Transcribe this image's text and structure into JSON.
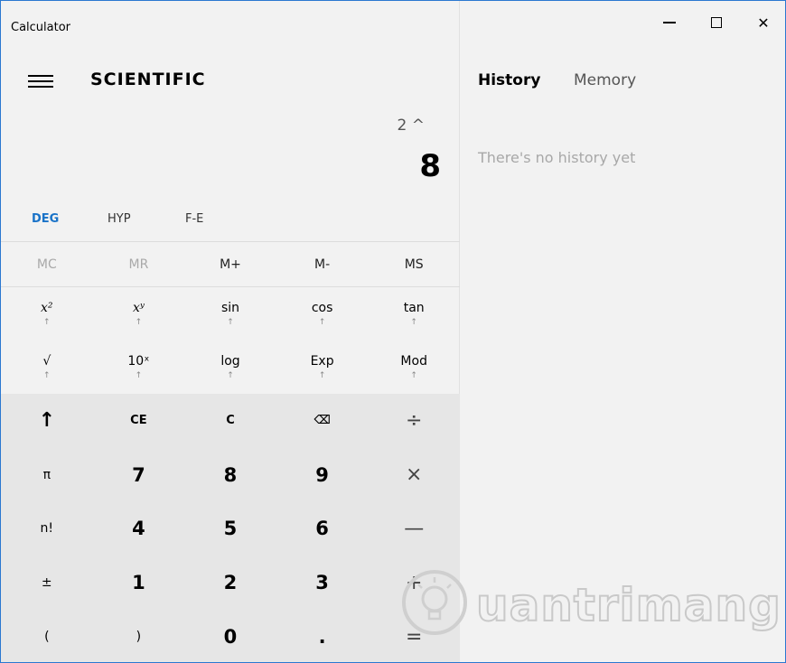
{
  "window": {
    "title": "Calculator",
    "controls": {
      "minimize": "—",
      "maximize": "",
      "close": "✕"
    }
  },
  "calculator": {
    "mode": "SCIENTIFIC",
    "display": {
      "expression": "2 ^",
      "result": "8"
    },
    "angle_modes": [
      "DEG",
      "HYP",
      "F-E"
    ],
    "memory": [
      "MC",
      "MR",
      "M+",
      "M-",
      "MS"
    ],
    "scientific": {
      "row1": [
        {
          "label": "x²",
          "arrow": "↑"
        },
        {
          "label": "xʸ",
          "arrow": "↑"
        },
        {
          "label": "sin",
          "arrow": "↑"
        },
        {
          "label": "cos",
          "arrow": "↑"
        },
        {
          "label": "tan",
          "arrow": "↑"
        }
      ],
      "row2": [
        {
          "label": "√",
          "arrow": "↑"
        },
        {
          "label": "10ˣ",
          "arrow": "↑"
        },
        {
          "label": "log",
          "arrow": "↑"
        },
        {
          "label": "Exp",
          "arrow": "↑"
        },
        {
          "label": "Mod",
          "arrow": "↑"
        }
      ]
    },
    "keys": [
      [
        "↑",
        "CE",
        "C",
        "⌫",
        "÷"
      ],
      [
        "π",
        "7",
        "8",
        "9",
        "×"
      ],
      [
        "n!",
        "4",
        "5",
        "6",
        "—"
      ],
      [
        "±",
        "1",
        "2",
        "3",
        "+"
      ],
      [
        "(",
        ")",
        "0",
        ".",
        "="
      ]
    ]
  },
  "history_pane": {
    "tabs": [
      "History",
      "Memory"
    ],
    "empty_message": "There's no history yet"
  },
  "watermark": {
    "text": "uantrimang",
    "icon": "lightbulb-logo",
    "color": "#c9c9c9"
  },
  "colors": {
    "accent": "#1a73c8",
    "keypad_bg": "#e6e6e6",
    "window_border": "#2b78d0"
  }
}
